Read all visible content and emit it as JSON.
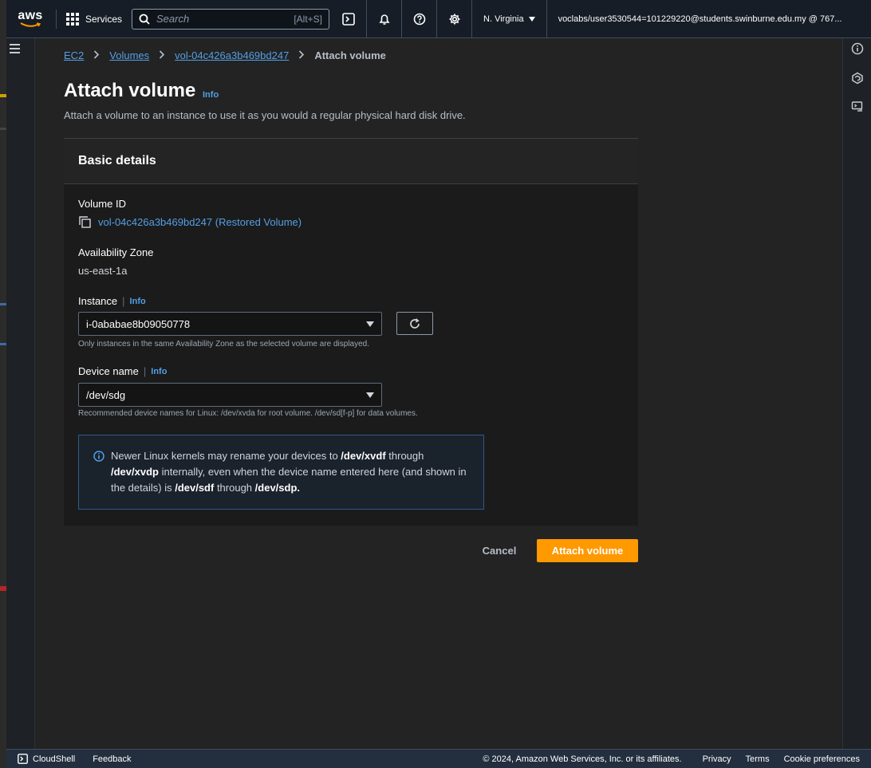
{
  "topnav": {
    "logo_text": "aws",
    "services_label": "Services",
    "search_placeholder": "Search",
    "search_shortcut": "[Alt+S]",
    "region_label": "N. Virginia",
    "account_label": "voclabs/user3530544=101229220@students.swinburne.edu.my @ 767..."
  },
  "breadcrumb": {
    "items": [
      "EC2",
      "Volumes",
      "vol-04c426a3b469bd247"
    ],
    "current": "Attach volume"
  },
  "page": {
    "title": "Attach volume",
    "info_label": "Info",
    "description": "Attach a volume to an instance to use it as you would a regular physical hard disk drive."
  },
  "basic_details": {
    "header": "Basic details",
    "volume_id_label": "Volume ID",
    "volume_id_value": "vol-04c426a3b469bd247 (Restored Volume)",
    "az_label": "Availability Zone",
    "az_value": "us-east-1a",
    "instance_label": "Instance",
    "instance_info": "Info",
    "instance_value": "i-0ababae8b09050778",
    "instance_hint": "Only instances in the same Availability Zone as the selected volume are displayed.",
    "device_label": "Device name",
    "device_info": "Info",
    "device_value": "/dev/sdg",
    "device_hint": "Recommended device names for Linux: /dev/xvda for root volume. /dev/sd[f-p] for data volumes."
  },
  "alert": {
    "t1": "Newer Linux kernels may rename your devices to ",
    "b1": "/dev/xvdf",
    "t2": " through ",
    "b2": "/dev/xvdp",
    "t3": " internally, even when the device name entered here (and shown in the details) is ",
    "b3": "/dev/sdf",
    "t4": " through ",
    "b4": "/dev/sdp."
  },
  "actions": {
    "cancel_label": "Cancel",
    "attach_label": "Attach volume"
  },
  "footer": {
    "cloudshell_label": "CloudShell",
    "feedback_label": "Feedback",
    "copyright": "© 2024, Amazon Web Services, Inc. or its affiliates.",
    "links": [
      "Privacy",
      "Terms",
      "Cookie preferences"
    ]
  },
  "colors": {
    "accent_link": "#539fe5",
    "primary_button": "#ff9900",
    "nav_bg": "#161d26"
  }
}
